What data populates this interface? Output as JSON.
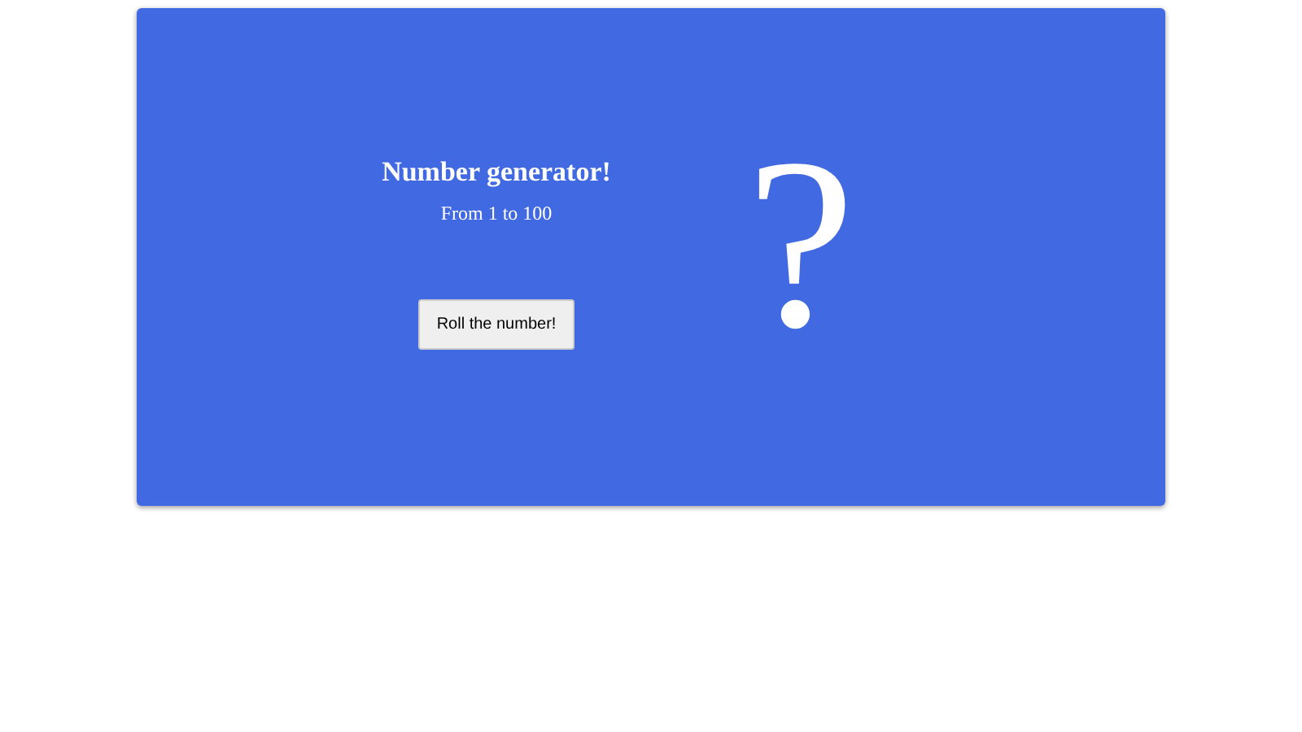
{
  "card": {
    "title": "Number generator!",
    "subtitle": "From 1 to 100",
    "button": "Roll the number!",
    "result": "?"
  }
}
